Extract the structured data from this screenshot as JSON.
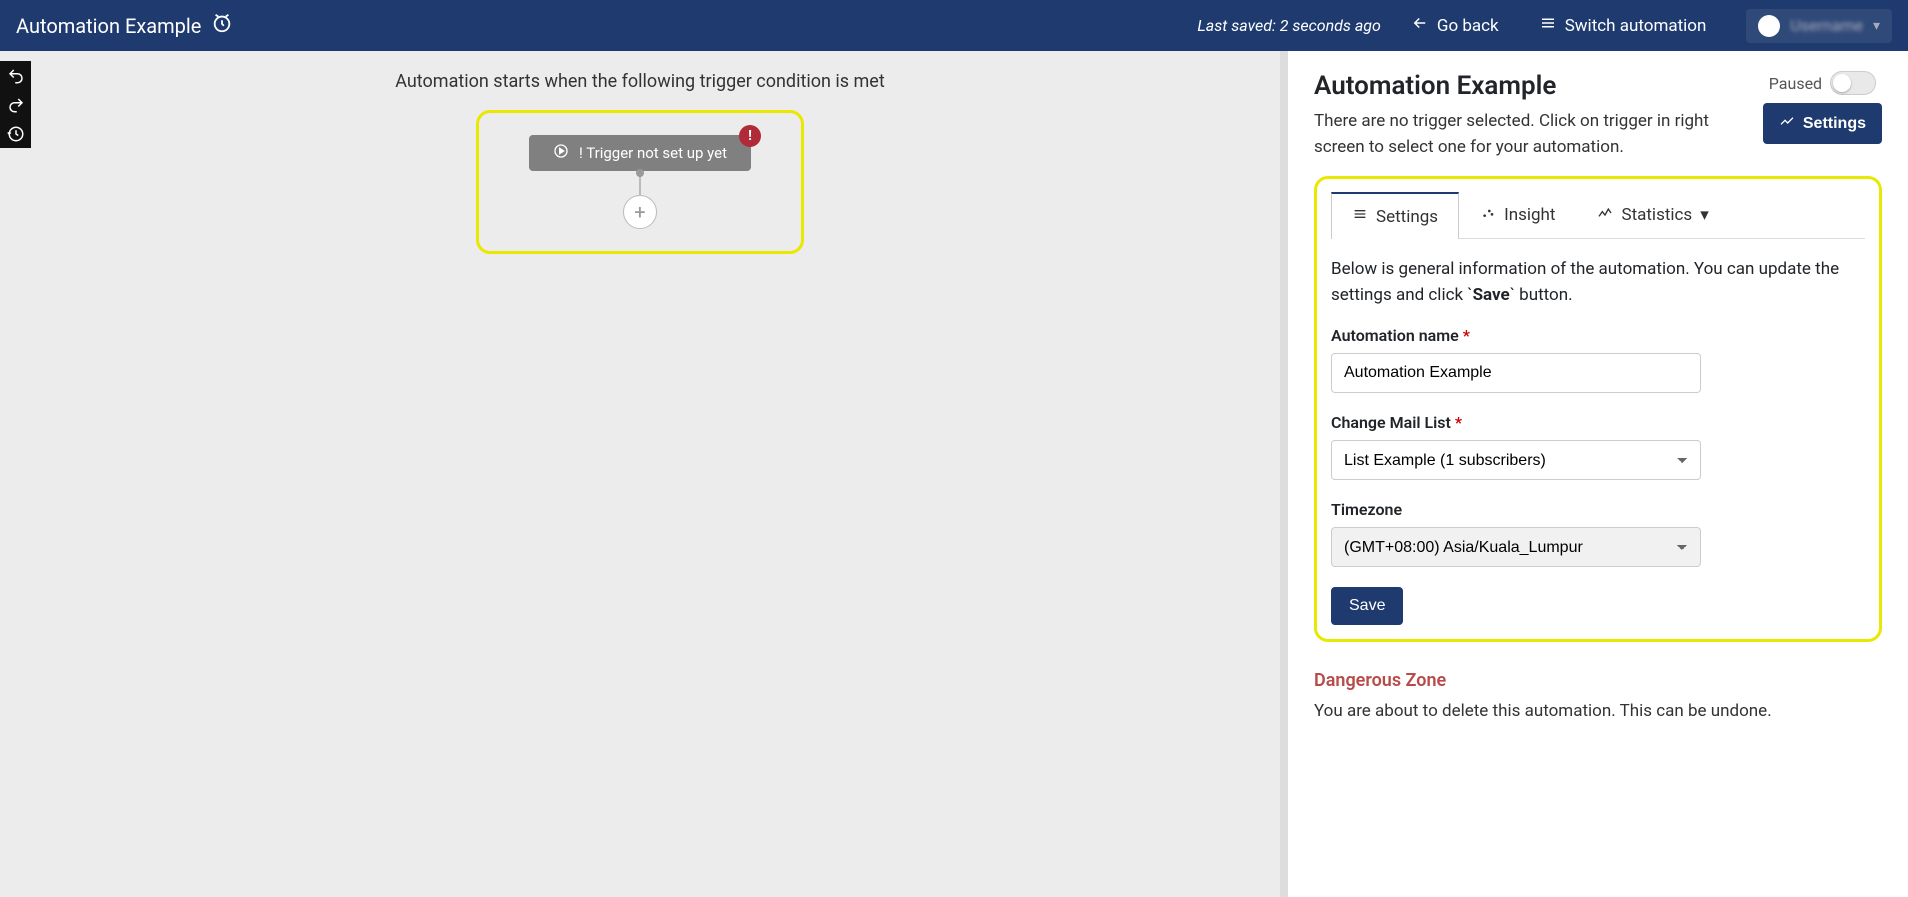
{
  "topbar": {
    "title": "Automation Example",
    "saved": "Last saved: 2 seconds ago",
    "go_back": "Go back",
    "switch": "Switch automation",
    "user": "Username"
  },
  "canvas": {
    "desc": "Automation starts when the following trigger condition is met",
    "trigger_label": "! Trigger not set up yet"
  },
  "panel": {
    "title": "Automation Example",
    "subtitle": "There are no trigger selected. Click on trigger in right screen to select one for your automation.",
    "paused": "Paused",
    "settings_btn": "Settings",
    "tabs": {
      "settings": "Settings",
      "insight": "Insight",
      "statistics": "Statistics"
    },
    "intro_before": "Below is general information of the automation. You can update the settings and click `",
    "intro_bold": "Save",
    "intro_after": "` button.",
    "form": {
      "name_label": "Automation name",
      "name_value": "Automation Example",
      "list_label": "Change Mail List",
      "list_value": "List Example (1 subscribers)",
      "tz_label": "Timezone",
      "tz_value": "(GMT+08:00) Asia/Kuala_Lumpur",
      "save": "Save"
    },
    "danger": {
      "title": "Dangerous Zone",
      "text": "You are about to delete this automation. This can be undone."
    }
  }
}
